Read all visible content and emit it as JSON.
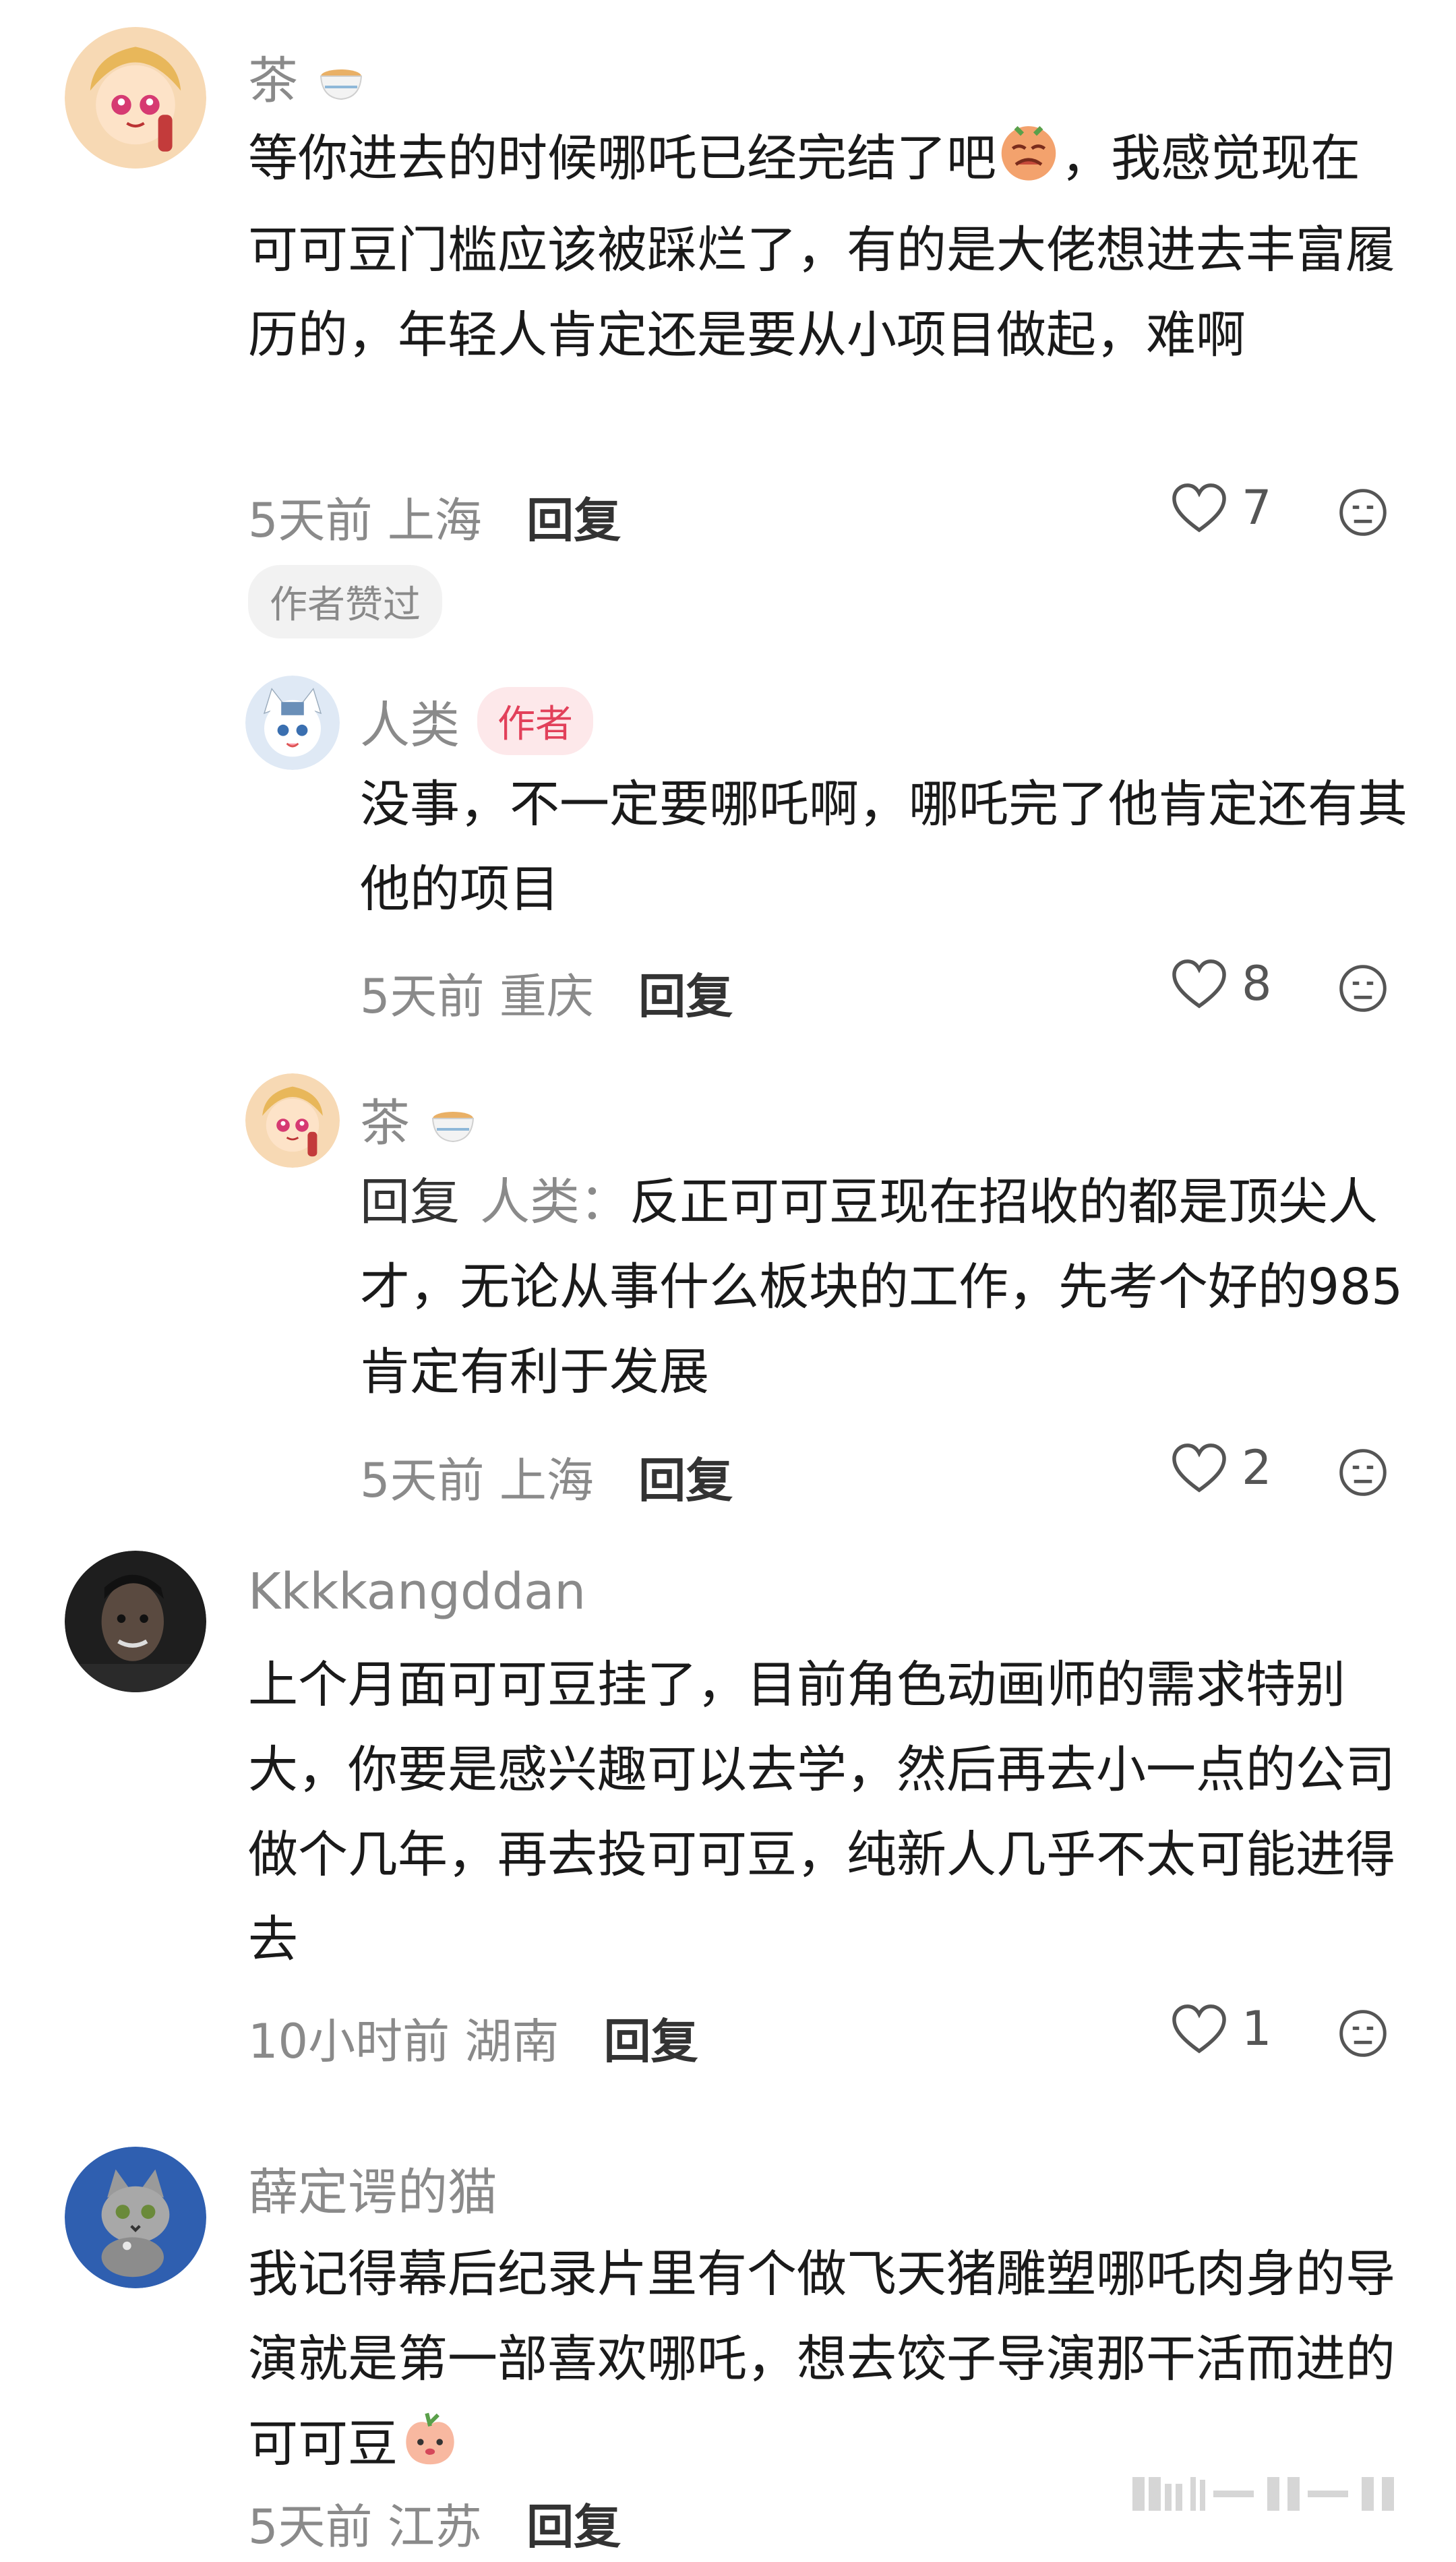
{
  "comments": [
    {
      "username": "茶",
      "text": "等你进去的时候哪吒已经完结了吧",
      "text_after_emoji": "，我感觉现在可可豆门槛应该被踩烂了，有的是大佬想进去丰富履历的，年轻人肯定还是要从小项目做起，难啊",
      "time": "5天前",
      "location": "上海",
      "reply_label": "回复",
      "likes": "7",
      "badge": "作者赞过"
    },
    {
      "username": "人类",
      "author_badge": "作者",
      "text": "没事，不一定要哪吒啊，哪吒完了他肯定还有其他的项目",
      "time": "5天前",
      "location": "重庆",
      "reply_label": "回复",
      "likes": "8"
    },
    {
      "username": "茶",
      "reply_prefix": "回复",
      "reply_target": "人类：",
      "text": "反正可可豆现在招收的都是顶尖人才，无论从事什么板块的工作，先考个好的985肯定有利于发展",
      "time": "5天前",
      "location": "上海",
      "reply_label": "回复",
      "likes": "2"
    },
    {
      "username": "Kkkkangddan",
      "text": "上个月面可可豆挂了，目前角色动画师的需求特别大，你要是感兴趣可以去学，然后再去小一点的公司做个几年，再去投可可豆，纯新人几乎不太可能进得去",
      "time": "10小时前",
      "location": "湖南",
      "reply_label": "回复",
      "likes": "1"
    },
    {
      "username": "薛定谔的猫",
      "text": "我记得幕后纪录片里有个做飞天猪雕塑哪吒肉身的导演就是第一部喜欢哪吒，想去饺子导演那干活而进的可可豆",
      "time": "5天前",
      "location": "江苏",
      "reply_label": "回复"
    }
  ],
  "icons": {
    "like": "heart-outline-icon",
    "dislike": "meh-face-icon",
    "tea": "tea-cup-emoji",
    "sob": "crying-face-emoji",
    "peach": "peach-face-emoji"
  },
  "colors": {
    "username": "#8a8a8a",
    "text": "#1a1a1a",
    "author_badge_bg": "#fde8ea",
    "author_badge_fg": "#e2405a"
  }
}
